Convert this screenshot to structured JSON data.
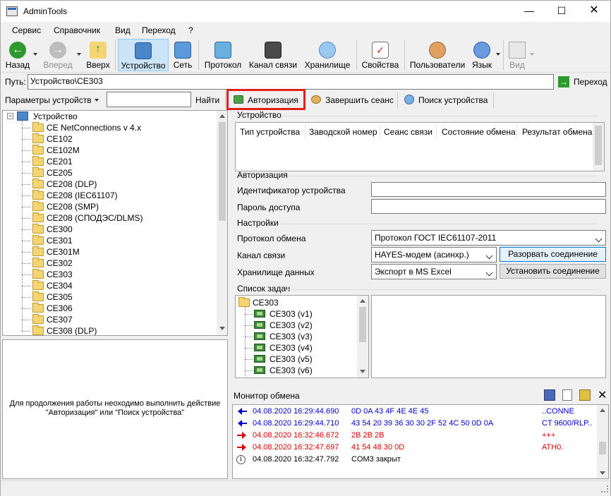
{
  "window": {
    "title": "AdminTools"
  },
  "menu": [
    "Сервис",
    "Справочник",
    "Вид",
    "Переход",
    "?"
  ],
  "toolbar": {
    "back": "Назад",
    "forward": "Вперед",
    "up": "Вверх",
    "device": "Устройство",
    "network": "Сеть",
    "protocol": "Протокол",
    "channel": "Канал связи",
    "storage": "Хранилище",
    "properties": "Свойства",
    "users": "Пользователи",
    "language": "Язык",
    "view": "Вид"
  },
  "path": {
    "label": "Путь:",
    "value": "Устройство\\CE303",
    "go": "Переход"
  },
  "params": {
    "dropdown": "Параметры устройств",
    "search_value": "",
    "find": "Найти",
    "auth": "Авторизация",
    "end_session": "Завершить сеанс",
    "device_search": "Поиск устройства"
  },
  "tree": {
    "root": "Устройство",
    "items": [
      "CE NetConnections v 4.x",
      "CE102",
      "CE102M",
      "CE201",
      "CE205",
      "CE208 (DLP)",
      "CE208 (IEC61107)",
      "CE208 (SMP)",
      "CE208 (СПОДЭС/DLMS)",
      "CE300",
      "CE301",
      "CE301M",
      "CE302",
      "CE303",
      "CE304",
      "CE305",
      "CE306",
      "CE307",
      "CE308 (DLP)"
    ]
  },
  "message": {
    "line1": "Для продолжения работы неоходимо выполнить действие",
    "line2": "\"Авторизация\" или \"Поиск устройства\""
  },
  "device_group": {
    "title": "Устройство",
    "columns": [
      "Тип устройства",
      "Заводской номер",
      "Сеанс связи",
      "Состояние обмена",
      "Результат обмена"
    ]
  },
  "auth_group": {
    "title": "Авторизация",
    "id_label": "Идентификатор устройства",
    "id_value": "",
    "pwd_label": "Пароль доступа",
    "pwd_value": ""
  },
  "settings": {
    "title": "Настройки",
    "protocol_label": "Протокол обмена",
    "protocol_value": "Протокол ГОСТ IEC61107-2011",
    "channel_label": "Канал связи",
    "channel_value": "HAYES-модем (асинхр.)",
    "disconnect": "Разорвать соединение",
    "storage_label": "Хранилище данных",
    "storage_value": "Экспорт в MS Excel",
    "connect": "Установить соединение"
  },
  "tasks": {
    "title": "Список задач",
    "root": "CE303",
    "items": [
      "CE303 (v1)",
      "CE303 (v2)",
      "CE303 (v3)",
      "CE303 (v4)",
      "CE303 (v5)",
      "CE303 (v6)"
    ]
  },
  "monitor": {
    "title": "Монитор обмена",
    "rows": [
      {
        "dir": "in",
        "time": "04.08.2020 16:29:44.690",
        "hex": "0D 0A 43 4F 4E 4E 45",
        "ascii": "..CONNE"
      },
      {
        "dir": "in",
        "time": "04.08.2020 16:29:44.710",
        "hex": "43 54 20 39 36 30 30 2F 52 4C 50 0D 0A",
        "ascii": "CT 9600/RLP.."
      },
      {
        "dir": "out",
        "time": "04.08.2020 16:32:46.672",
        "hex": "2B 2B 2B",
        "ascii": "+++"
      },
      {
        "dir": "out",
        "time": "04.08.2020 16:32:47.697",
        "hex": "41 54 48 30 0D",
        "ascii": "ATH0."
      },
      {
        "dir": "info",
        "time": "04.08.2020 16:32:47.792",
        "hex": "COM3 закрыт",
        "ascii": ""
      }
    ]
  },
  "colors": {
    "in": "#0000d0",
    "out": "#e00000",
    "info": "#000000",
    "highlight": "#e0201a"
  }
}
